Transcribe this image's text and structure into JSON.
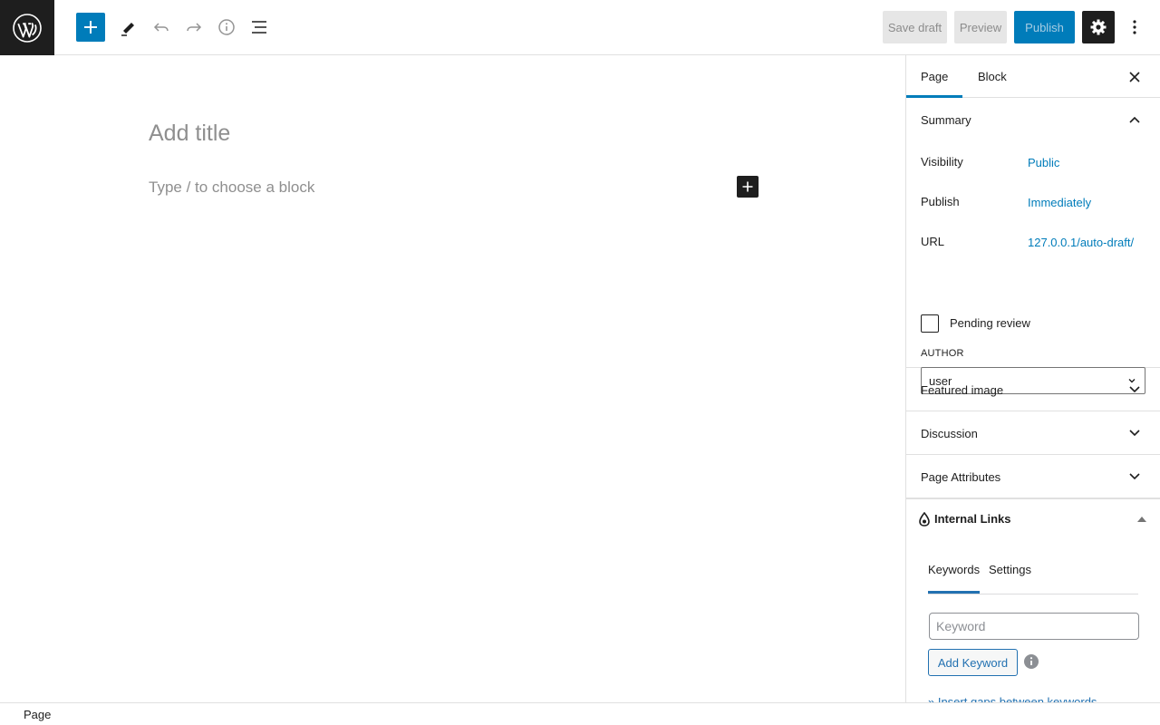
{
  "toolbar": {
    "save_draft": "Save draft",
    "preview": "Preview",
    "publish": "Publish"
  },
  "editor": {
    "title_placeholder": "Add title",
    "block_placeholder": "Type / to choose a block"
  },
  "sidebar": {
    "tabs": [
      {
        "label": "Page",
        "active": true
      },
      {
        "label": "Block",
        "active": false
      }
    ],
    "summary": {
      "title": "Summary",
      "rows": [
        {
          "label": "Visibility",
          "value": "Public"
        },
        {
          "label": "Publish",
          "value": "Immediately"
        },
        {
          "label": "URL",
          "value": "127.0.0.1/auto-draft/"
        }
      ],
      "pending_review": "Pending review",
      "pending_review_checked": false,
      "author_label": "AUTHOR",
      "author_value": "user"
    },
    "panels": [
      {
        "title": "Featured image"
      },
      {
        "title": "Discussion"
      },
      {
        "title": "Page Attributes"
      }
    ],
    "internal_links": {
      "title": "Internal Links",
      "tabs": [
        {
          "label": "Keywords",
          "active": true
        },
        {
          "label": "Settings",
          "active": false
        }
      ],
      "keyword_placeholder": "Keyword",
      "add_button": "Add Keyword",
      "insert_gaps_link": "» Insert gaps between keywords"
    }
  },
  "footer": {
    "breadcrumb": "Page"
  },
  "colors": {
    "accent": "#007cba",
    "dark": "#1e1e1e",
    "border": "#e0e0e0",
    "wp_admin_blue": "#2271b1"
  }
}
